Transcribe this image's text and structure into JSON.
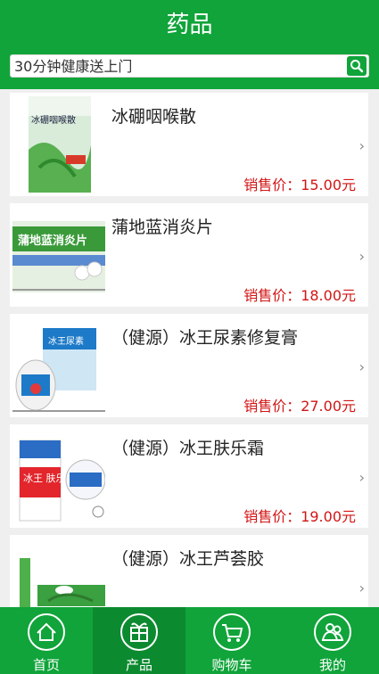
{
  "header": {
    "title": "药品"
  },
  "search": {
    "placeholder": "30分钟健康送上门"
  },
  "products": [
    {
      "name": "冰硼咽喉散",
      "price": "销售价：15.00元",
      "box_text": "冰硼咽喉散"
    },
    {
      "name": "蒲地蓝消炎片",
      "price": "销售价：18.00元",
      "box_text": "蒲地蓝消炎片"
    },
    {
      "name": "（健源）冰王尿素修复膏",
      "price": "销售价：27.00元",
      "box_text": "冰王尿素"
    },
    {
      "name": "（健源）冰王肤乐霜",
      "price": "销售价：19.00元",
      "box_text": "冰王\n肤乐霜"
    },
    {
      "name": "（健源）冰王芦荟胶",
      "price": "",
      "box_text": ""
    }
  ],
  "tabbar": {
    "items": [
      {
        "label": "首页",
        "icon": "home-icon"
      },
      {
        "label": "产品",
        "icon": "gift-icon"
      },
      {
        "label": "购物车",
        "icon": "cart-icon"
      },
      {
        "label": "我的",
        "icon": "user-icon"
      }
    ],
    "active": 1
  },
  "colors": {
    "brand": "#10a43a",
    "brand_dark": "#0c8a30",
    "price": "#d21515"
  }
}
